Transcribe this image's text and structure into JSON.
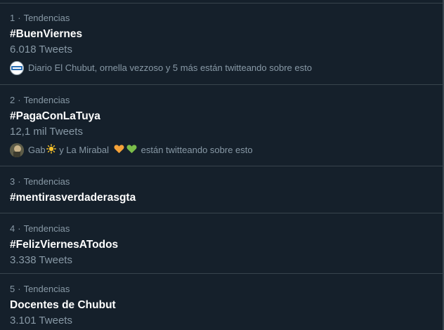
{
  "trends": [
    {
      "rank": "1",
      "category": "Tendencias",
      "name": "#BuenViernes",
      "tweets": "6.018 Tweets",
      "context": "Diario El Chubut, ornella vezzoso y 5 más están twitteando sobre esto"
    },
    {
      "rank": "2",
      "category": "Tendencias",
      "name": "#PagaConLaTuya",
      "tweets": "12,1 mil Tweets",
      "context_name1": "Gab",
      "context_mid": " y La Mirabal ",
      "context_tail": "están twitteando sobre esto"
    },
    {
      "rank": "3",
      "category": "Tendencias",
      "name": "#mentirasverdaderasgta"
    },
    {
      "rank": "4",
      "category": "Tendencias",
      "name": "#FelizViernesATodos",
      "tweets": "3.338 Tweets"
    },
    {
      "rank": "5",
      "category": "Tendencias",
      "name": "Docentes de Chubut",
      "tweets": "3.101 Tweets"
    }
  ],
  "separator": "·",
  "colors": {
    "background": "#15202b",
    "divider": "#38444d",
    "secondary_text": "#8899a6",
    "primary_text": "#ffffff",
    "heart_orange": "#f4a239",
    "heart_green": "#7bbd4a",
    "sun": "#f7c22b"
  },
  "icons": {
    "avatar1": "diario-el-chubut-avatar",
    "avatar2": "gab-avatar",
    "sun": "sun-emoji",
    "heart1": "orange-heart-emoji",
    "heart2": "green-heart-emoji"
  }
}
